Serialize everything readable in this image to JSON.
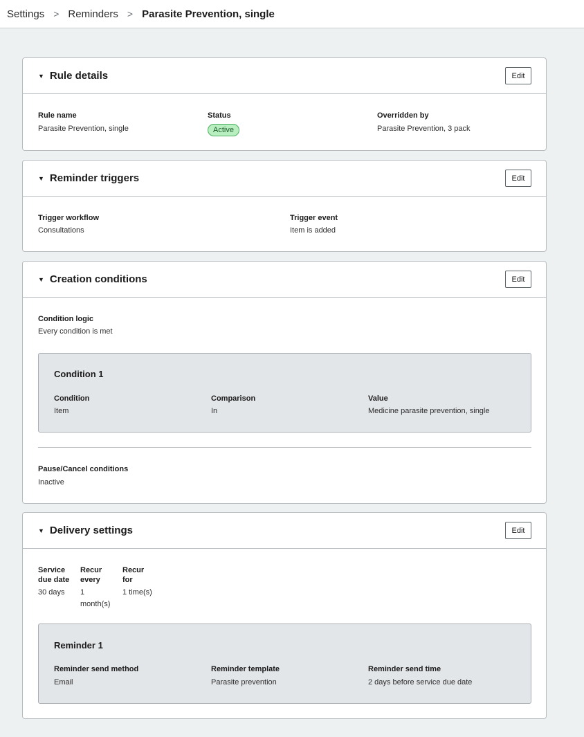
{
  "breadcrumb": {
    "items": [
      "Settings",
      "Reminders"
    ],
    "current": "Parasite Prevention, single",
    "separator": ">"
  },
  "edit_label": "Edit",
  "rule_details": {
    "title": "Rule details",
    "rule_name_label": "Rule name",
    "rule_name_value": "Parasite Prevention, single",
    "status_label": "Status",
    "status_value": "Active",
    "overridden_label": "Overridden by",
    "overridden_value": "Parasite Prevention, 3 pack"
  },
  "reminder_triggers": {
    "title": "Reminder triggers",
    "workflow_label": "Trigger workflow",
    "workflow_value": "Consultations",
    "event_label": "Trigger event",
    "event_value": "Item is added"
  },
  "creation_conditions": {
    "title": "Creation conditions",
    "logic_label": "Condition logic",
    "logic_value": "Every condition is met",
    "condition": {
      "title": "Condition 1",
      "condition_label": "Condition",
      "condition_value": "Item",
      "comparison_label": "Comparison",
      "comparison_value": "In",
      "value_label": "Value",
      "value_value": "Medicine parasite prevention, single"
    },
    "pause_label": "Pause/Cancel conditions",
    "pause_value": "Inactive"
  },
  "delivery_settings": {
    "title": "Delivery settings",
    "due_label_1": "Service",
    "due_label_2": "due date",
    "due_value": "30 days",
    "recur_every_label_1": "Recur",
    "recur_every_label_2": "every",
    "recur_every_value_1": "1",
    "recur_every_value_2": "month(s)",
    "recur_for_label_1": "Recur",
    "recur_for_label_2": "for",
    "recur_for_value": "1 time(s)",
    "reminder": {
      "title": "Reminder 1",
      "method_label": "Reminder send method",
      "method_value": "Email",
      "template_label": "Reminder template",
      "template_value": "Parasite prevention",
      "time_label": "Reminder send time",
      "time_value": "2 days before service due date"
    }
  },
  "colors": {
    "page_bg": "#eef1f2",
    "card_border": "#b7bcc0",
    "inner_box_bg": "#e3e6e9",
    "badge_bg": "#b9efc0",
    "badge_border": "#4caf62"
  }
}
